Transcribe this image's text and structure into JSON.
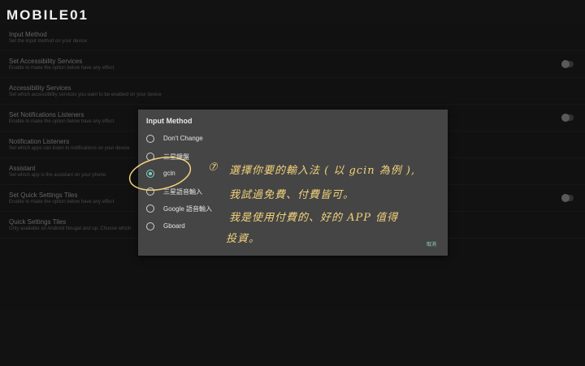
{
  "brand": {
    "name": "MOBILE01"
  },
  "settings": [
    {
      "title": "Input Method",
      "subtitle": "Set the input method on your device",
      "toggle": false
    },
    {
      "title": "Set Accessibility Services",
      "subtitle": "Enable to make the option below have any effect",
      "toggle": true
    },
    {
      "title": "Accessibility Services",
      "subtitle": "Set which accessibility services you want to be enabled on your device",
      "toggle": false
    },
    {
      "title": "Set Notifications Listeners",
      "subtitle": "Enable to make the option below have any effect",
      "toggle": true
    },
    {
      "title": "Notification Listeners",
      "subtitle": "Set which apps can listen to notifications on your device",
      "toggle": false
    },
    {
      "title": "Assistant",
      "subtitle": "Set which app is the assistant on your phone",
      "toggle": false
    },
    {
      "title": "Set Quick Settings Tiles",
      "subtitle": "Enable to make the option below have any effect",
      "toggle": true
    },
    {
      "title": "Quick Settings Tiles",
      "subtitle": "Only available on Android Nougat and up. Choose which",
      "toggle": false
    }
  ],
  "dialog": {
    "title": "Input Method",
    "options": [
      {
        "label": "Don't Change",
        "selected": false
      },
      {
        "label": "三星鍵盤",
        "selected": false
      },
      {
        "label": "gcin",
        "selected": true
      },
      {
        "label": "三星語音輸入",
        "selected": false
      },
      {
        "label": "Google 語音輸入",
        "selected": false
      },
      {
        "label": "Gboard",
        "selected": false
      }
    ],
    "cancel": "取消"
  },
  "annotation": {
    "number": "⑦",
    "line1": "選擇你要的輸入法 ( 以 gcin 為例 ),",
    "line2": "我試過免費、付費皆可。",
    "line3": "我是使用付費的、好的 APP 值得",
    "line4": "投資。",
    "color": "#f2d27a"
  }
}
